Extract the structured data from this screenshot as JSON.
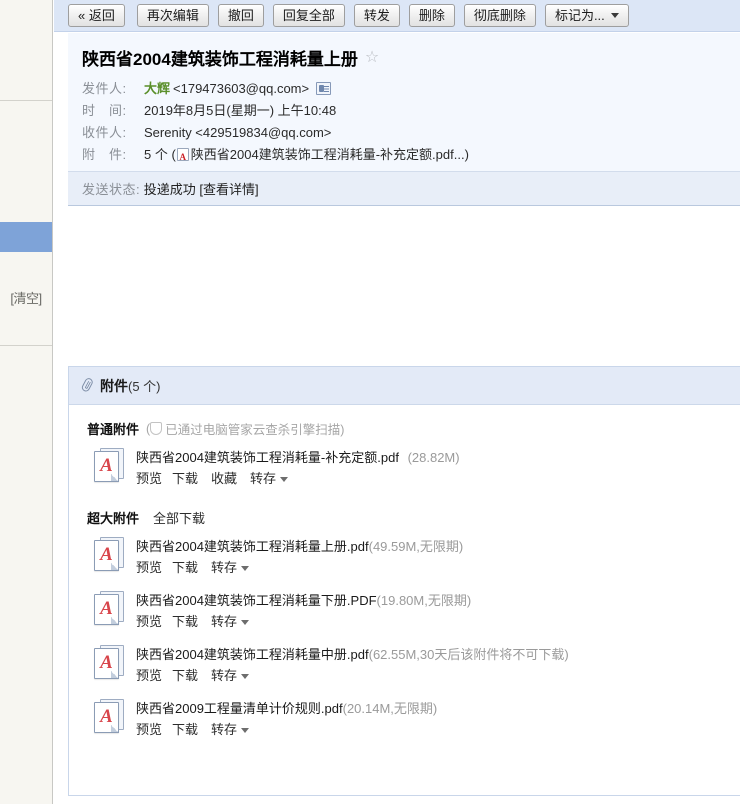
{
  "sidebar": {
    "clear_label": "[清空]"
  },
  "toolbar": {
    "buttons": [
      {
        "label": "« 返回",
        "caret": false
      },
      {
        "label": "再次编辑",
        "caret": false
      },
      {
        "label": "撤回",
        "caret": false
      },
      {
        "label": "回复全部",
        "caret": false
      },
      {
        "label": "转发",
        "caret": false
      },
      {
        "label": "删除",
        "caret": false
      },
      {
        "label": "彻底删除",
        "caret": false
      },
      {
        "label": "标记为...",
        "caret": true
      }
    ]
  },
  "mail": {
    "subject": "陕西省2004建筑装饰工程消耗量上册",
    "from_label": "发件人:",
    "from_name": "大辉",
    "from_address": "<179473603@qq.com>",
    "date_label": "时　间:",
    "date_value": "2019年8月5日(星期一) 上午10:48",
    "to_label": "收件人:",
    "to_value": "Serenity <429519834@qq.com>",
    "attach_label": "附　件:",
    "attach_count_text": "5 个 (",
    "attach_first_name": "陕西省2004建筑装饰工程消耗量-补充定额.pdf...)",
    "status_label": "发送状态:",
    "status_value": "投递成功",
    "status_detail": "[查看详情]"
  },
  "attachments_panel": {
    "title": "附件",
    "count_text": "(5 个)",
    "normal_section": {
      "title": "普通附件",
      "note_open": "(",
      "note": "已通过电脑管家云查杀引擎扫描)",
      "items": [
        {
          "name": "陕西省2004建筑装饰工程消耗量-补充定额.pdf",
          "size": "(28.82M)",
          "actions": [
            "预览",
            "下载",
            "收藏",
            "转存"
          ]
        }
      ]
    },
    "large_section": {
      "title": "超大附件",
      "download_all": "全部下载",
      "items": [
        {
          "name": "陕西省2004建筑装饰工程消耗量上册.pdf",
          "size": "(49.59M,无限期)",
          "actions": [
            "预览",
            "下载",
            "转存"
          ]
        },
        {
          "name": "陕西省2004建筑装饰工程消耗量下册.PDF",
          "size": "(19.80M,无限期)",
          "actions": [
            "预览",
            "下载",
            "转存"
          ]
        },
        {
          "name": "陕西省2004建筑装饰工程消耗量中册.pdf",
          "size": "(62.55M,30天后该附件将不可下载)",
          "actions": [
            "预览",
            "下载",
            "转存"
          ]
        },
        {
          "name": "陕西省2009工程量清单计价规则.pdf",
          "size": "(20.14M,无限期)",
          "actions": [
            "预览",
            "下载",
            "转存"
          ]
        }
      ]
    }
  },
  "icons": {
    "star": "☆",
    "pdf_glyph": "A",
    "paperclip": "paperclip-icon",
    "contact_card": "contact-card-icon",
    "shield": "shield-icon"
  },
  "colors": {
    "toolbar_bg": "#dce6f6",
    "header_bg": "#f4f8fe",
    "status_bg": "#e8eef8",
    "panel_head_bg": "#e3eaf7",
    "sidebar_bg": "#f7f6f1",
    "sidebar_selected": "#7ea3d8",
    "sender_green": "#5a8f2a",
    "pdf_red": "#d8454b",
    "muted_gray": "#9a9a9a"
  }
}
